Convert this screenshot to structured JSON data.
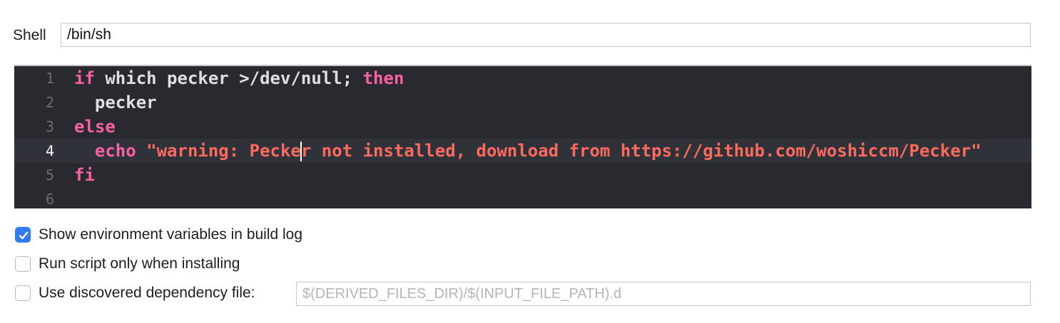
{
  "shell": {
    "label": "Shell",
    "value": "/bin/sh"
  },
  "editor": {
    "current_line": 4,
    "lines": [
      {
        "number": "1",
        "tokens": [
          {
            "kind": "keyword",
            "text": "if"
          },
          {
            "kind": "plain",
            "text": " which pecker >/dev/null; "
          },
          {
            "kind": "keyword",
            "text": "then"
          }
        ]
      },
      {
        "number": "2",
        "tokens": [
          {
            "kind": "plain",
            "text": "  pecker"
          }
        ]
      },
      {
        "number": "3",
        "tokens": [
          {
            "kind": "keyword",
            "text": "else"
          }
        ]
      },
      {
        "number": "4",
        "tokens": [
          {
            "kind": "plain",
            "text": "  "
          },
          {
            "kind": "keyword",
            "text": "echo"
          },
          {
            "kind": "plain",
            "text": " "
          },
          {
            "kind": "string",
            "text": "\"warning: Pecke"
          },
          {
            "kind": "caret",
            "text": ""
          },
          {
            "kind": "string",
            "text": "r not installed, download from https://github.com/woshiccm/Pecker\""
          }
        ]
      },
      {
        "number": "5",
        "tokens": [
          {
            "kind": "keyword",
            "text": "fi"
          }
        ]
      },
      {
        "number": "6",
        "tokens": []
      }
    ]
  },
  "options": {
    "show_env": {
      "label": "Show environment variables in build log",
      "checked": true
    },
    "run_only_installing": {
      "label": "Run script only when installing",
      "checked": false
    },
    "use_dep_file": {
      "label": "Use discovered dependency file:",
      "checked": false,
      "placeholder": "$(DERIVED_FILES_DIR)/$(INPUT_FILE_PATH).d",
      "value": ""
    }
  },
  "colors": {
    "accent": "#2f7cf6",
    "editor_bg": "#292a30",
    "keyword": "#fc5fa3",
    "string": "#fc6a5d",
    "plain_code": "#dfdfe0"
  }
}
